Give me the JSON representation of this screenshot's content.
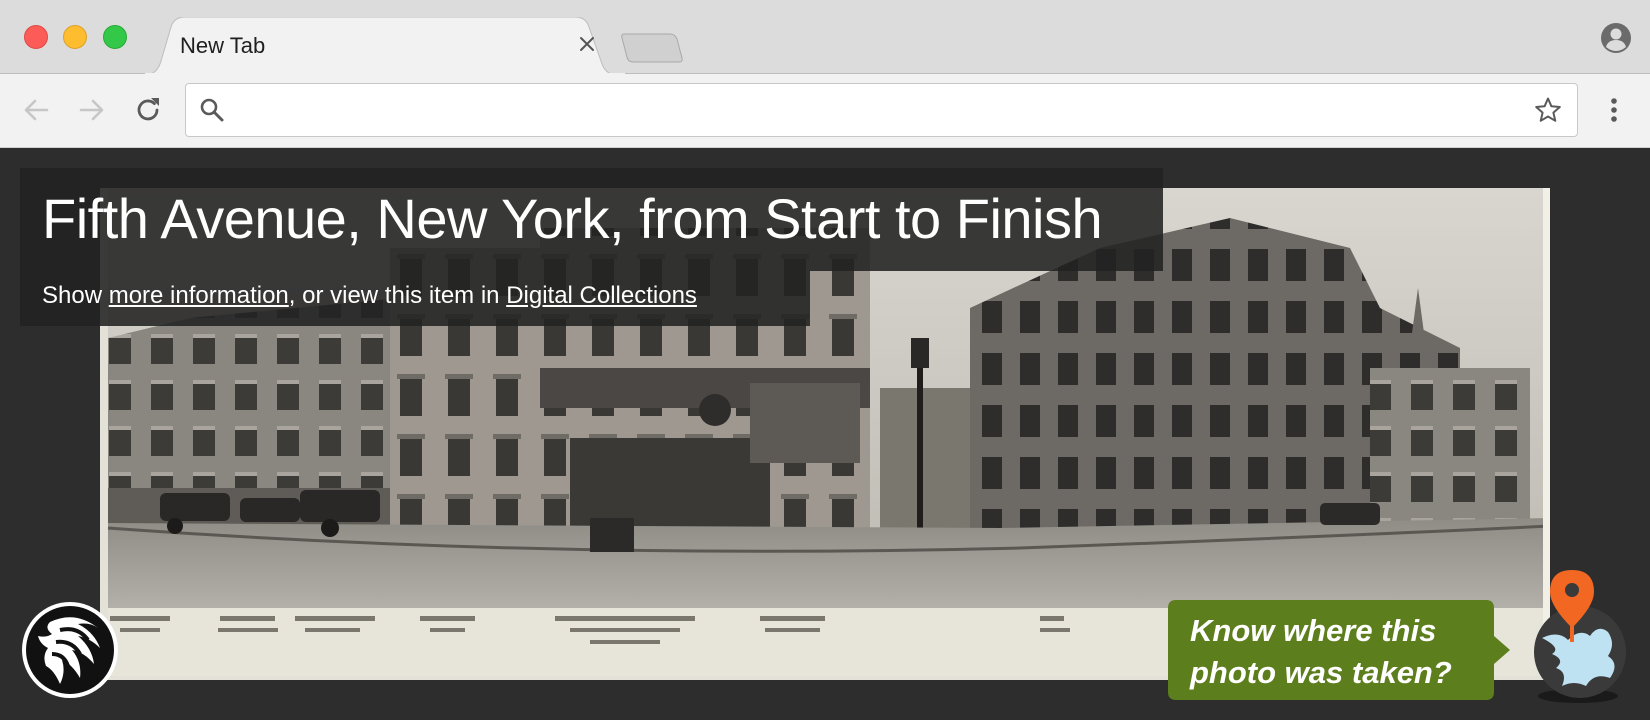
{
  "browser": {
    "tab_title": "New Tab",
    "address": {
      "value": "",
      "placeholder": ""
    },
    "icons": {
      "close": "close-icon",
      "back": "arrow-left-icon",
      "forward": "arrow-right-icon",
      "reload": "reload-icon",
      "search": "search-icon",
      "bookmark": "star-icon",
      "menu": "kebab-menu-icon",
      "profile": "account-icon"
    }
  },
  "page": {
    "title": "Fifth Avenue, New York, from Start to Finish",
    "info_prefix": "Show ",
    "more_info_link": "more information",
    "info_middle": ", or view this item in ",
    "collections_link": "Digital Collections",
    "cta_text": "Know where this photo was taken?",
    "logo": "nypl-lion-logo",
    "colors": {
      "cta_green": "#5d7e1c",
      "pin_orange": "#f26722",
      "overlay": "#222222"
    }
  }
}
